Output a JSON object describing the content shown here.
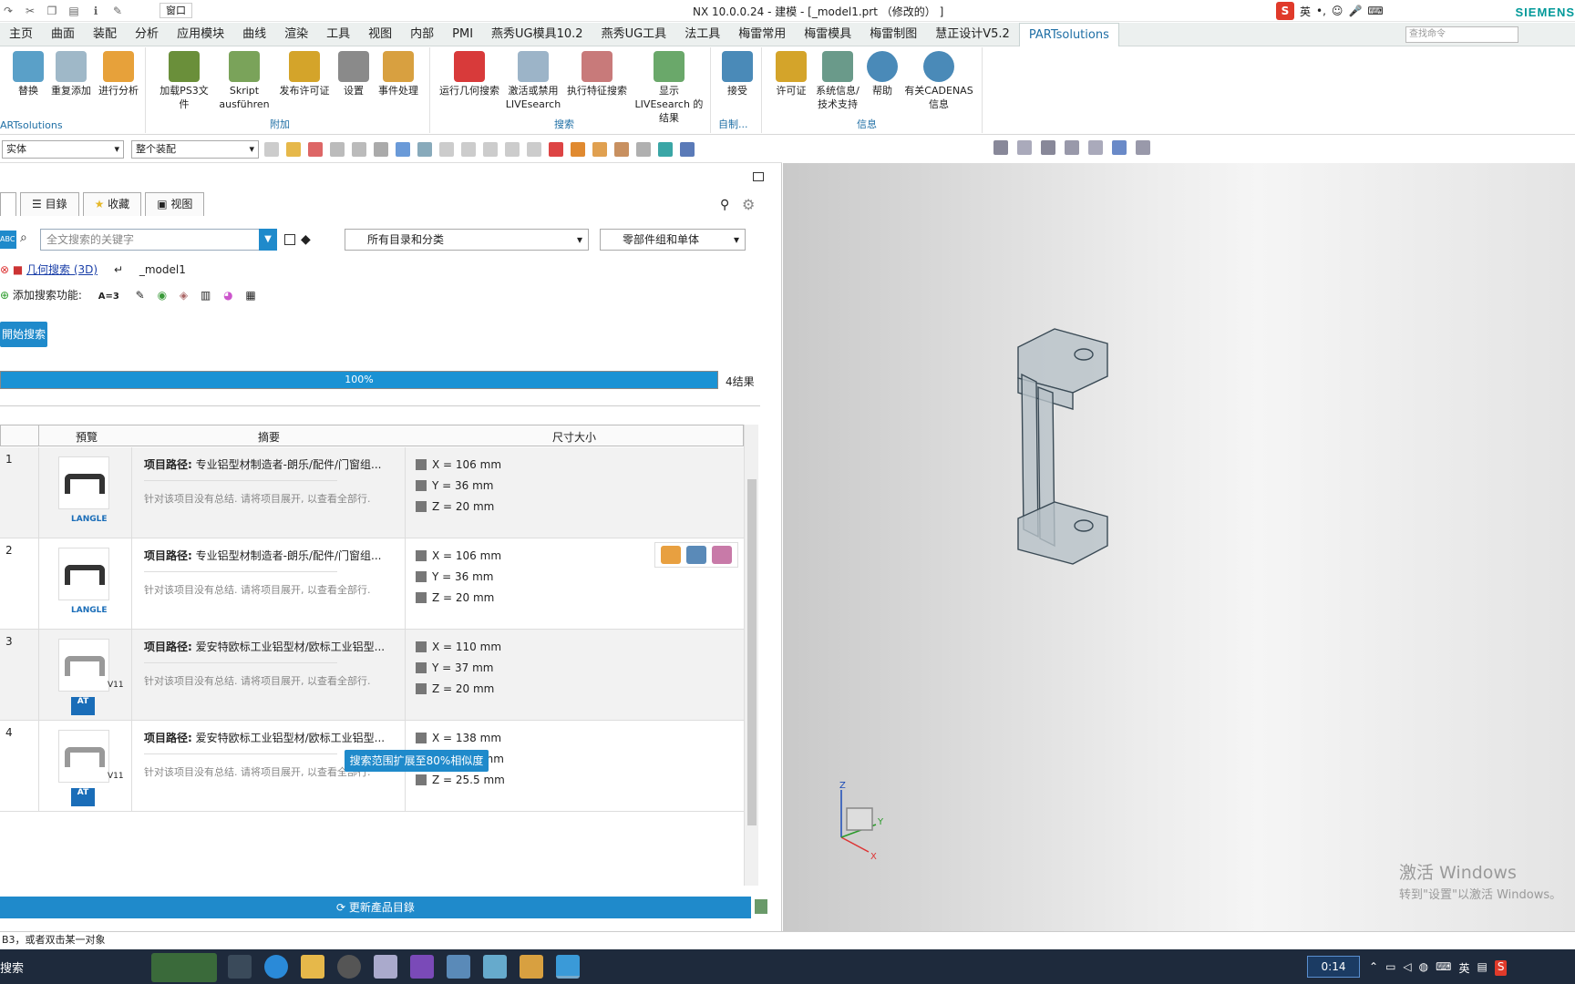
{
  "titlebar": {
    "window_menu": "窗口",
    "title": "NX 10.0.0.24 - 建模 - [_model1.prt （修改的） ]",
    "ime_lang": "英",
    "brand": "SIEMENS"
  },
  "menubar": {
    "tabs": [
      "主页",
      "曲面",
      "装配",
      "分析",
      "应用模块",
      "曲线",
      "渲染",
      "工具",
      "视图",
      "内部",
      "PMI",
      "燕秀UG模具10.2",
      "燕秀UG工具",
      "法工具",
      "梅雷常用",
      "梅雷模具",
      "梅雷制图",
      "慧正设计V5.2",
      "PARTsolutions"
    ],
    "active_tab": "PARTsolutions",
    "command_search_placeholder": "查找命令"
  },
  "ribbon": {
    "groups": [
      {
        "label": "ARTsolutions",
        "buttons": [
          "替换",
          "重复添加",
          "进行分析"
        ]
      },
      {
        "label": "附加",
        "buttons": [
          "加载PS3文件",
          "Skript ausführen",
          "发布许可证",
          "设置",
          "事件处理"
        ]
      },
      {
        "label": "搜索",
        "buttons": [
          "运行几何搜索",
          "激活或禁用 LIVEsearch",
          "执行特征搜索",
          "显示LIVEsearch 的结果"
        ]
      },
      {
        "label": "自制...",
        "buttons": [
          "接受"
        ]
      },
      {
        "label": "信息",
        "buttons": [
          "许可证",
          "系统信息/ 技术支持",
          "帮助",
          "有关CADENAS 信息"
        ]
      }
    ]
  },
  "toolbar2": {
    "filter_type": "实体",
    "filter_scope": "整个装配"
  },
  "panel": {
    "tabs": [
      "目錄",
      "收藏",
      "视图"
    ],
    "search_placeholder": "全文搜索的关键字",
    "category_dropdown": "所有目录和分类",
    "type_dropdown": "零部件组和单体",
    "geo_search_link": "几何搜索 (3D)",
    "geo_model": "_model1",
    "add_search_label": "添加搜索功能:",
    "add_search_fn": "A=3",
    "start_search_label": "開始搜索",
    "progress_text": "100%",
    "progress_value": 1.0,
    "results_count": "4结果",
    "columns": [
      "預覽",
      "摘要",
      "尺寸大小"
    ],
    "rows": [
      {
        "num": "1",
        "path": "项目路径: 专业铝型材制造者-朗乐/配件/门窗组...",
        "summary": "针对该项目没有总结. 请将项目展开, 以查看全部行.",
        "x": "X = 106 mm",
        "y": "Y = 36 mm",
        "z": "Z = 20 mm",
        "vendor": "LANGLE"
      },
      {
        "num": "2",
        "path": "项目路径: 专业铝型材制造者-朗乐/配件/门窗组...",
        "summary": "针对该项目没有总结. 请将项目展开, 以查看全部行.",
        "x": "X = 106 mm",
        "y": "Y = 36 mm",
        "z": "Z = 20 mm",
        "vendor": "LANGLE"
      },
      {
        "num": "3",
        "path": "项目路径: 爱安特欧标工业铝型材/欧标工业铝型...",
        "summary": "针对该项目没有总结. 请将项目展开, 以查看全部行.",
        "x": "X = 110 mm",
        "y": "Y = 37 mm",
        "z": "Z = 20 mm",
        "vendor": "AT",
        "badge": "V11"
      },
      {
        "num": "4",
        "path": "项目路径: 爱安特欧标工业铝型材/欧标工业铝型...",
        "summary": "针对该项目没有总结. 请将项目展开, 以查看全部行.",
        "x": "X = 138 mm",
        "y": "Y = 43.5 mm",
        "z": "Z = 25.5 mm",
        "vendor": "AT",
        "badge": "V11"
      }
    ],
    "expand_button": "搜索范围扩展至80%相似度",
    "update_button": "更新產品目錄"
  },
  "viewport": {
    "watermark_title": "激活 Windows",
    "watermark_sub": "转到\"设置\"以激活 Windows。"
  },
  "statusbar": {
    "text": "B3，或者双击某一对象"
  },
  "taskbar": {
    "search_label": "搜索",
    "timer": "0:14",
    "ime": "英"
  }
}
